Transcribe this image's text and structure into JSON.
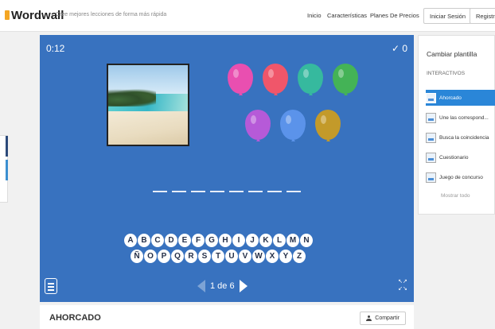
{
  "header": {
    "logo": "Wordwall",
    "tagline": "Cree mejores lecciones de forma más rápida",
    "nav": [
      "Inicio",
      "Características",
      "Planes De Precios"
    ],
    "login_label": "Iniciar Sesión",
    "register_label": "Registra"
  },
  "game": {
    "timer": "0:12",
    "score": "✓ 0",
    "balloon_colors": [
      "#e94fb0",
      "#f0566a",
      "#36b99e",
      "#44b356",
      "#b65ad8",
      "#5b93ea",
      "#c39a2a"
    ],
    "letters_row1": [
      "A",
      "B",
      "C",
      "D",
      "E",
      "F",
      "G",
      "H",
      "I",
      "J",
      "K",
      "L",
      "M",
      "N"
    ],
    "letters_row2": [
      "Ñ",
      "O",
      "P",
      "Q",
      "R",
      "S",
      "T",
      "U",
      "V",
      "W",
      "X",
      "Y",
      "Z"
    ],
    "word_length": 8,
    "pager": "1 de 6"
  },
  "sidepanel": {
    "title": "Cambiar plantilla",
    "section": "INTERACTIVOS",
    "items": [
      "Ahorcado",
      "Une las correspond...",
      "Busca la coincidencia",
      "Cuestionario",
      "Juego de concurso"
    ],
    "more": "Mostrar todo"
  },
  "footer": {
    "title": "AHORCADO",
    "share_label": "Compartir"
  }
}
